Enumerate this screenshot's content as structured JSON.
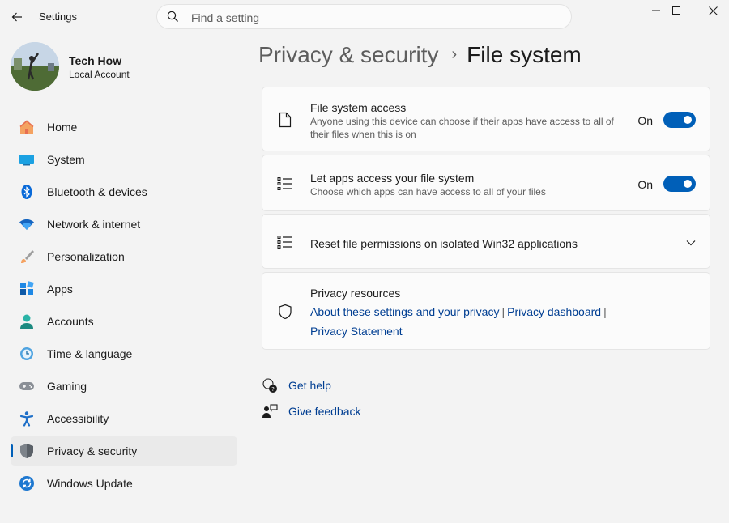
{
  "window": {
    "title": "Settings"
  },
  "search": {
    "placeholder": "Find a setting"
  },
  "profile": {
    "name": "Tech How",
    "account_type": "Local Account"
  },
  "sidebar": {
    "items": [
      {
        "label": "Home",
        "icon": "home-icon",
        "selected": false
      },
      {
        "label": "System",
        "icon": "system-icon",
        "selected": false
      },
      {
        "label": "Bluetooth & devices",
        "icon": "bluetooth-icon",
        "selected": false
      },
      {
        "label": "Network & internet",
        "icon": "wifi-icon",
        "selected": false
      },
      {
        "label": "Personalization",
        "icon": "brush-icon",
        "selected": false
      },
      {
        "label": "Apps",
        "icon": "apps-icon",
        "selected": false
      },
      {
        "label": "Accounts",
        "icon": "accounts-icon",
        "selected": false
      },
      {
        "label": "Time & language",
        "icon": "time-language-icon",
        "selected": false
      },
      {
        "label": "Gaming",
        "icon": "gamepad-icon",
        "selected": false
      },
      {
        "label": "Accessibility",
        "icon": "accessibility-icon",
        "selected": false
      },
      {
        "label": "Privacy & security",
        "icon": "shield-icon",
        "selected": true
      },
      {
        "label": "Windows Update",
        "icon": "update-icon",
        "selected": false
      }
    ]
  },
  "breadcrumb": {
    "parent": "Privacy & security",
    "separator": "›",
    "current": "File system"
  },
  "settings": {
    "file_system_access": {
      "title": "File system access",
      "description": "Anyone using this device can choose if their apps have access to all of their files when this is on",
      "state_label": "On",
      "enabled": true
    },
    "apps_access": {
      "title": "Let apps access your file system",
      "description": "Choose which apps can have access to all of your files",
      "state_label": "On",
      "enabled": true
    },
    "reset_permissions": {
      "title": "Reset file permissions on isolated Win32 applications"
    }
  },
  "privacy_resources": {
    "title": "Privacy resources",
    "links": [
      "About these settings and your privacy",
      "Privacy dashboard",
      "Privacy Statement"
    ],
    "separator": "|"
  },
  "help": {
    "get_help": "Get help",
    "give_feedback": "Give feedback"
  },
  "colors": {
    "accent": "#005fb8",
    "link": "#003e92",
    "background": "#f3f3f3",
    "card": "#fbfbfb"
  }
}
